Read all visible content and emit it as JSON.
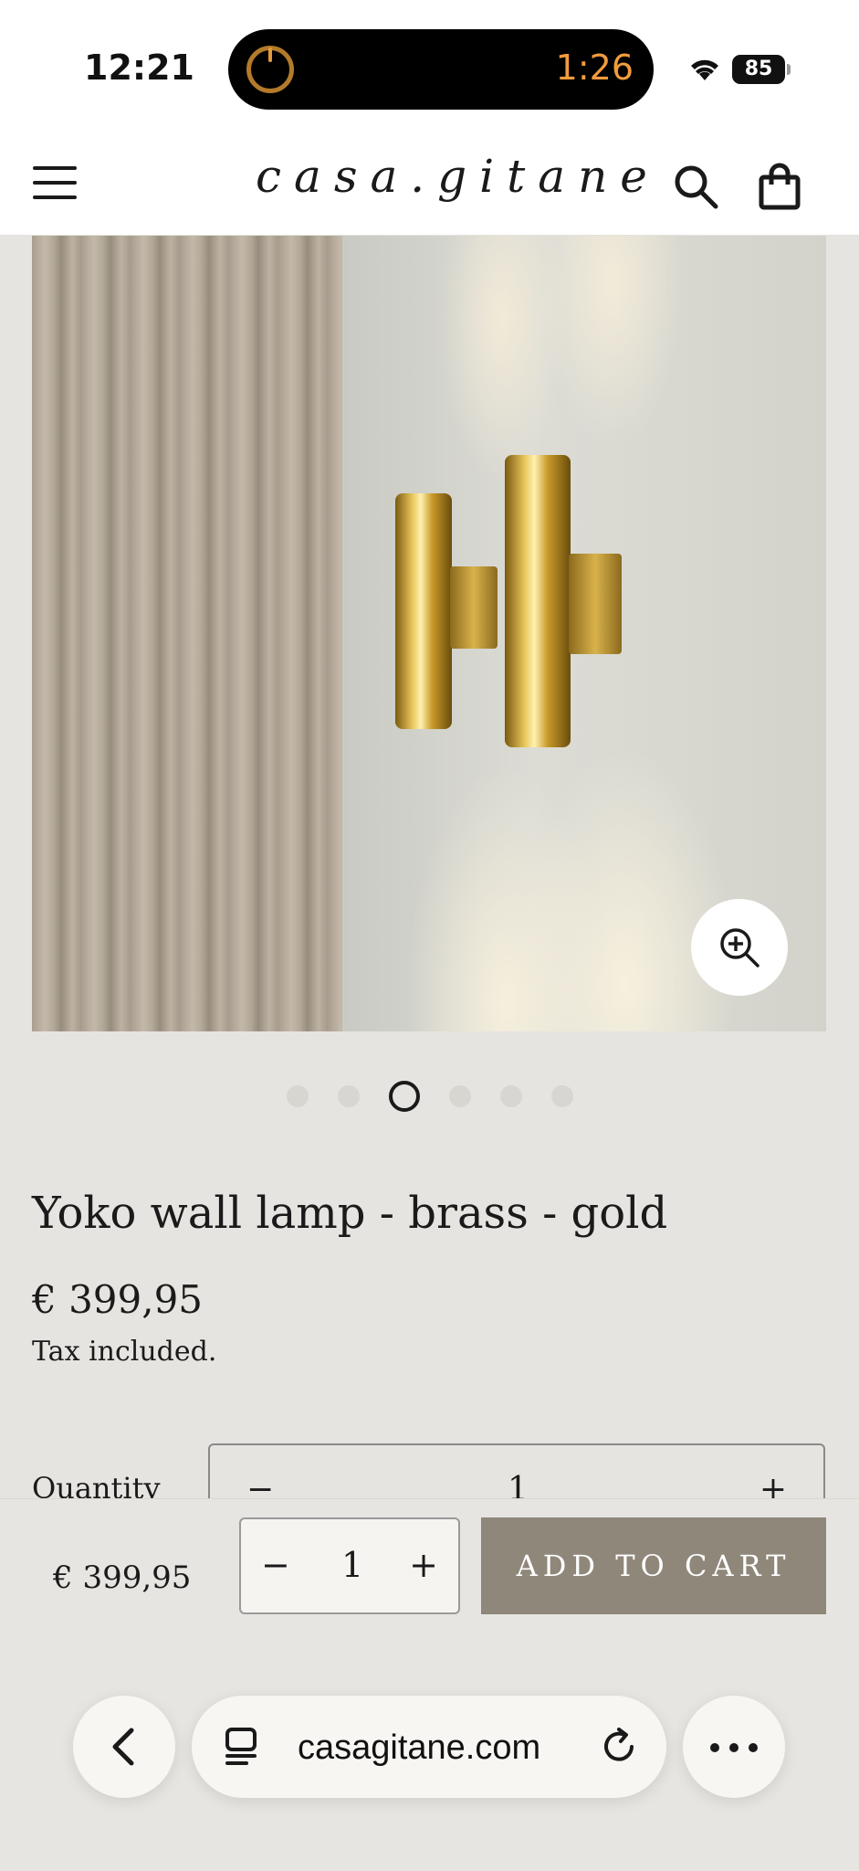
{
  "status_bar": {
    "time": "12:21",
    "timer": "1:26",
    "battery": "85"
  },
  "header": {
    "logo": "casa.gitane"
  },
  "product": {
    "title": "Yoko wall lamp - brass - gold",
    "price": "€ 399,95",
    "tax_note": "Tax included.",
    "quantity_label": "Quantity",
    "quantity_value": "1",
    "image_count": 6,
    "active_image_index": 3
  },
  "sticky_bar": {
    "price": "€ 399,95",
    "minus": "−",
    "quantity": "1",
    "plus": "+",
    "add_to_cart": "ADD TO CART"
  },
  "browser": {
    "url": "casagitane.com"
  },
  "colors": {
    "page_bg": "#e6e4e0",
    "button_bg": "#8f877a",
    "timer": "#f29c3b"
  }
}
